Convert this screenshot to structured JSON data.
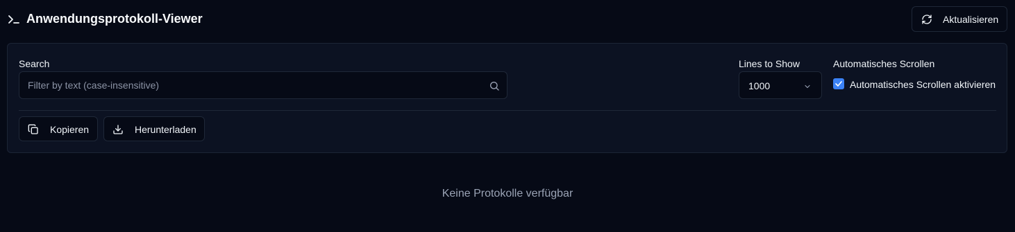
{
  "header": {
    "title": "Anwendungsprotokoll-Viewer",
    "title_icon": "terminal-icon",
    "refresh_label": "Aktualisieren",
    "refresh_icon": "refresh-icon"
  },
  "filters": {
    "search": {
      "label": "Search",
      "placeholder": "Filter by text (case-insensitive)",
      "value": "",
      "icon": "search-icon"
    },
    "lines": {
      "label": "Lines to Show",
      "selected": "1000",
      "icon": "chevron-down-icon"
    },
    "autoscroll": {
      "label": "Automatisches Scrollen",
      "checkbox_label": "Automatisches Scrollen aktivieren",
      "checked": true
    }
  },
  "actions": {
    "copy_label": "Kopieren",
    "copy_icon": "copy-icon",
    "download_label": "Herunterladen",
    "download_icon": "download-icon"
  },
  "log": {
    "empty_message": "Keine Protokolle verfügbar"
  },
  "colors": {
    "background": "#060a16",
    "panel": "#0c1222",
    "border": "#1f2838",
    "accent": "#3b82f6",
    "muted_text": "#9aa3b5"
  }
}
